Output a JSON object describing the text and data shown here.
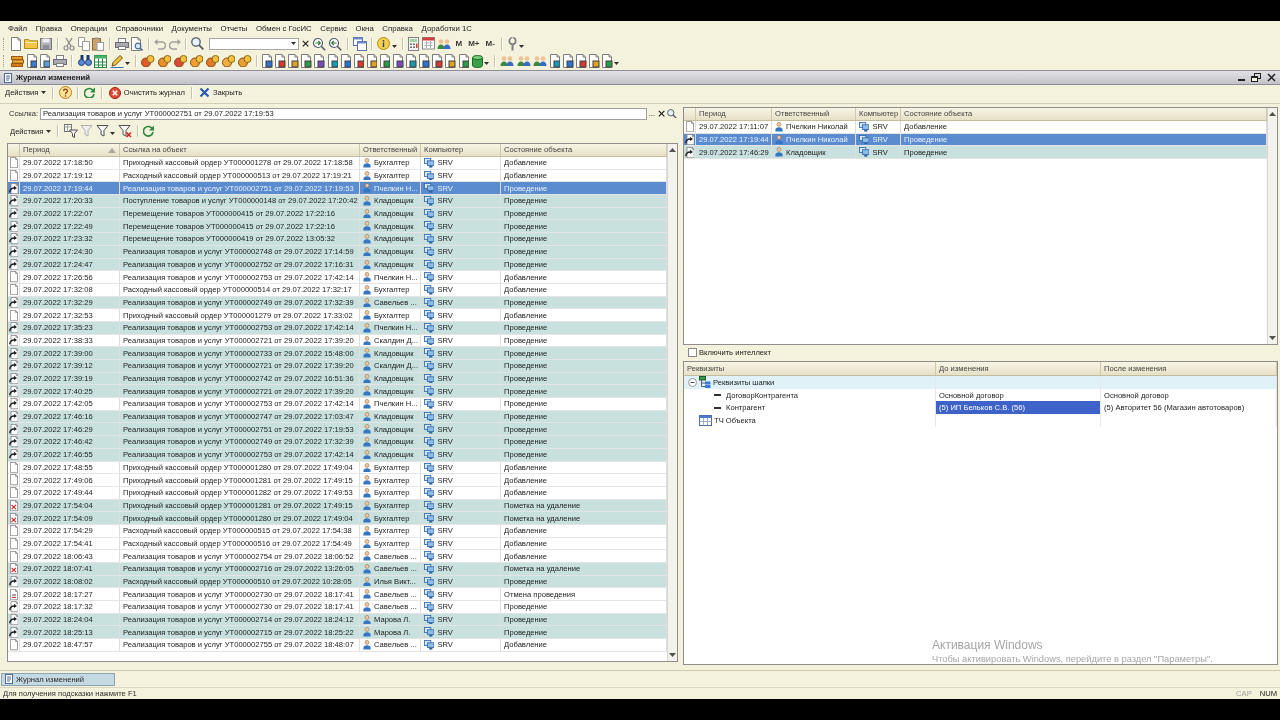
{
  "menu_bar": [
    "Файл",
    "Правка",
    "Операции",
    "Справочники",
    "Документы",
    "Отчеты",
    "Обмен с ГосИС",
    "Сервис",
    "Окна",
    "Справка",
    "Доработки 1С"
  ],
  "toolbar": {
    "memory_buttons": [
      "M",
      "M+",
      "M-"
    ]
  },
  "window": {
    "title": "Журнал изменений",
    "actions": [
      {
        "kind": "menu",
        "label": "Действия"
      },
      {
        "kind": "help"
      },
      {
        "kind": "refresh"
      },
      {
        "kind": "clear",
        "label": "Очистить журнал"
      },
      {
        "kind": "close",
        "label": "Закрыть"
      }
    ]
  },
  "link_field": {
    "label": "Ссылка:",
    "value": "Реализация товаров и услуг УТ000002751 от 29.07.2022 17:19:53",
    "select_button": "..."
  },
  "list_toolbar": {
    "actions": [
      {
        "kind": "menu",
        "label": "Действия"
      },
      {
        "kind": "filter_value"
      },
      {
        "kind": "filter_off"
      },
      {
        "kind": "filter_menu"
      },
      {
        "kind": "filter_clear"
      },
      {
        "kind": "refresh"
      }
    ]
  },
  "log_table": {
    "columns": [
      {
        "label": "Период",
        "sorted": true
      },
      {
        "label": "Ссылка на объект",
        "sorted": false
      },
      {
        "label": "Ответственный",
        "sorted": false
      },
      {
        "label": "Компьютер",
        "sorted": false
      },
      {
        "label": "Состояние объекта",
        "sorted": false
      }
    ],
    "rows": [
      {
        "kind": "added",
        "period": "29.07.2022 17:18:50",
        "object": "Приходный кассовый ордер УТ000001278 от 29.07.2022 17:18:58",
        "user": "Бухгалтер",
        "computer": "SRV",
        "state": "Добавление",
        "highlighted": false,
        "selected": false
      },
      {
        "kind": "added",
        "period": "29.07.2022 17:19:12",
        "object": "Расходный кассовый ордер УТ000000513 от 29.07.2022 17:19:21",
        "user": "Бухгалтер",
        "computer": "SRV",
        "state": "Добавление",
        "highlighted": false,
        "selected": false
      },
      {
        "kind": "posted",
        "period": "29.07.2022 17:19:44",
        "object": "Реализация товаров и услуг УТ000002751 от 29.07.2022 17:19:53",
        "user": "Пчелкин Н...",
        "computer": "SRV",
        "state": "Проведение",
        "highlighted": true,
        "selected": true
      },
      {
        "kind": "posted",
        "period": "29.07.2022 17:20:33",
        "object": "Поступление товаров и услуг УТ000000148 от 29.07.2022 17:20:42",
        "user": "Кладовщик",
        "computer": "SRV",
        "state": "Проведение",
        "highlighted": true,
        "selected": false
      },
      {
        "kind": "posted",
        "period": "29.07.2022 17:22:07",
        "object": "Перемещение товаров УТ000000415 от 29.07.2022 17:22:16",
        "user": "Кладовщик",
        "computer": "SRV",
        "state": "Проведение",
        "highlighted": true,
        "selected": false
      },
      {
        "kind": "posted",
        "period": "29.07.2022 17:22:49",
        "object": "Перемещение товаров УТ000000415 от 29.07.2022 17:22:16",
        "user": "Кладовщик",
        "computer": "SRV",
        "state": "Проведение",
        "highlighted": true,
        "selected": false
      },
      {
        "kind": "posted",
        "period": "29.07.2022 17:23:32",
        "object": "Перемещение товаров УТ000000419 от 29.07.2022 13:05:32",
        "user": "Кладовщик",
        "computer": "SRV",
        "state": "Проведение",
        "highlighted": true,
        "selected": false
      },
      {
        "kind": "posted",
        "period": "29.07.2022 17:24:30",
        "object": "Реализация товаров и услуг УТ000002748 от 29.07.2022 17:14:59",
        "user": "Кладовщик",
        "computer": "SRV",
        "state": "Проведение",
        "highlighted": true,
        "selected": false
      },
      {
        "kind": "posted",
        "period": "29.07.2022 17:24:47",
        "object": "Реализация товаров и услуг УТ000002752 от 29.07.2022 17:16:31",
        "user": "Кладовщик",
        "computer": "SRV",
        "state": "Проведение",
        "highlighted": true,
        "selected": false
      },
      {
        "kind": "added",
        "period": "29.07.2022 17:26:56",
        "object": "Реализация товаров и услуг УТ000002753 от 29.07.2022 17:42:14",
        "user": "Пчелкин Н...",
        "computer": "SRV",
        "state": "Добавление",
        "highlighted": false,
        "selected": false
      },
      {
        "kind": "added",
        "period": "29.07.2022 17:32:08",
        "object": "Расходный кассовый ордер УТ000000514 от 29.07.2022 17:32:17",
        "user": "Бухгалтер",
        "computer": "SRV",
        "state": "Добавление",
        "highlighted": false,
        "selected": false
      },
      {
        "kind": "posted",
        "period": "29.07.2022 17:32:29",
        "object": "Реализация товаров и услуг УТ000002749 от 29.07.2022 17:32:39",
        "user": "Савельев ...",
        "computer": "SRV",
        "state": "Проведение",
        "highlighted": true,
        "selected": false
      },
      {
        "kind": "added",
        "period": "29.07.2022 17:32:53",
        "object": "Приходный кассовый ордер УТ000001279 от 29.07.2022 17:33:02",
        "user": "Бухгалтер",
        "computer": "SRV",
        "state": "Добавление",
        "highlighted": false,
        "selected": false
      },
      {
        "kind": "posted",
        "period": "29.07.2022 17:35:23",
        "object": "Реализация товаров и услуг УТ000002753 от 29.07.2022 17:42:14",
        "user": "Пчелкин Н...",
        "computer": "SRV",
        "state": "Проведение",
        "highlighted": true,
        "selected": false
      },
      {
        "kind": "posted",
        "period": "29.07.2022 17:38:33",
        "object": "Реализация товаров и услуг УТ000002721 от 29.07.2022 17:39:20",
        "user": "Скалдин Д...",
        "computer": "SRV",
        "state": "Проведение",
        "highlighted": false,
        "selected": false
      },
      {
        "kind": "posted",
        "period": "29.07.2022 17:39:00",
        "object": "Реализация товаров и услуг УТ000002733 от 29.07.2022 15:48:00",
        "user": "Кладовщик",
        "computer": "SRV",
        "state": "Проведение",
        "highlighted": true,
        "selected": false
      },
      {
        "kind": "posted",
        "period": "29.07.2022 17:39:12",
        "object": "Реализация товаров и услуг УТ000002721 от 29.07.2022 17:39:20",
        "user": "Скалдин Д...",
        "computer": "SRV",
        "state": "Проведение",
        "highlighted": true,
        "selected": false
      },
      {
        "kind": "posted",
        "period": "29.07.2022 17:39:19",
        "object": "Реализация товаров и услуг УТ000002742 от 29.07.2022 16:51:36",
        "user": "Кладовщик",
        "computer": "SRV",
        "state": "Проведение",
        "highlighted": true,
        "selected": false
      },
      {
        "kind": "posted",
        "period": "29.07.2022 17:40:25",
        "object": "Реализация товаров и услуг УТ000002721 от 29.07.2022 17:39:20",
        "user": "Кладовщик",
        "computer": "SRV",
        "state": "Проведение",
        "highlighted": true,
        "selected": false
      },
      {
        "kind": "posted",
        "period": "29.07.2022 17:42:05",
        "object": "Реализация товаров и услуг УТ000002753 от 29.07.2022 17:42:14",
        "user": "Пчелкин Н...",
        "computer": "SRV",
        "state": "Проведение",
        "highlighted": false,
        "selected": false
      },
      {
        "kind": "posted",
        "period": "29.07.2022 17:46:16",
        "object": "Реализация товаров и услуг УТ000002747 от 29.07.2022 17:03:47",
        "user": "Кладовщик",
        "computer": "SRV",
        "state": "Проведение",
        "highlighted": true,
        "selected": false
      },
      {
        "kind": "posted",
        "period": "29.07.2022 17:46:29",
        "object": "Реализация товаров и услуг УТ000002751 от 29.07.2022 17:19:53",
        "user": "Кладовщик",
        "computer": "SRV",
        "state": "Проведение",
        "highlighted": true,
        "selected": false
      },
      {
        "kind": "posted",
        "period": "29.07.2022 17:46:42",
        "object": "Реализация товаров и услуг УТ000002749 от 29.07.2022 17:32:39",
        "user": "Кладовщик",
        "computer": "SRV",
        "state": "Проведение",
        "highlighted": true,
        "selected": false
      },
      {
        "kind": "posted",
        "period": "29.07.2022 17:46:55",
        "object": "Реализация товаров и услуг УТ000002753 от 29.07.2022 17:42:14",
        "user": "Кладовщик",
        "computer": "SRV",
        "state": "Проведение",
        "highlighted": true,
        "selected": false
      },
      {
        "kind": "added",
        "period": "29.07.2022 17:48:55",
        "object": "Приходный кассовый ордер УТ000001280 от 29.07.2022 17:49:04",
        "user": "Бухгалтер",
        "computer": "SRV",
        "state": "Добавление",
        "highlighted": false,
        "selected": false
      },
      {
        "kind": "added",
        "period": "29.07.2022 17:49:06",
        "object": "Приходный кассовый ордер УТ000001281 от 29.07.2022 17:49:15",
        "user": "Бухгалтер",
        "computer": "SRV",
        "state": "Добавление",
        "highlighted": false,
        "selected": false
      },
      {
        "kind": "added",
        "period": "29.07.2022 17:49:44",
        "object": "Приходный кассовый ордер УТ000001282 от 29.07.2022 17:49:53",
        "user": "Бухгалтер",
        "computer": "SRV",
        "state": "Добавление",
        "highlighted": false,
        "selected": false
      },
      {
        "kind": "marked",
        "period": "29.07.2022 17:54:04",
        "object": "Приходный кассовый ордер УТ000001281 от 29.07.2022 17:49:15",
        "user": "Бухгалтер",
        "computer": "SRV",
        "state": "Пометка на удаление",
        "highlighted": true,
        "selected": false
      },
      {
        "kind": "marked",
        "period": "29.07.2022 17:54:09",
        "object": "Приходный кассовый ордер УТ000001280 от 29.07.2022 17:49:04",
        "user": "Бухгалтер",
        "computer": "SRV",
        "state": "Пометка на удаление",
        "highlighted": true,
        "selected": false
      },
      {
        "kind": "added",
        "period": "29.07.2022 17:54:29",
        "object": "Расходный кассовый ордер УТ000000515 от 29.07.2022 17:54:38",
        "user": "Бухгалтер",
        "computer": "SRV",
        "state": "Добавление",
        "highlighted": false,
        "selected": false
      },
      {
        "kind": "added",
        "period": "29.07.2022 17:54:41",
        "object": "Расходный кассовый ордер УТ000000516 от 29.07.2022 17:54:49",
        "user": "Бухгалтер",
        "computer": "SRV",
        "state": "Добавление",
        "highlighted": false,
        "selected": false
      },
      {
        "kind": "added",
        "period": "29.07.2022 18:06:43",
        "object": "Реализация товаров и услуг УТ000002754 от 29.07.2022 18:06:52",
        "user": "Савельев ...",
        "computer": "SRV",
        "state": "Добавление",
        "highlighted": false,
        "selected": false
      },
      {
        "kind": "marked",
        "period": "29.07.2022 18:07:41",
        "object": "Реализация товаров и услуг УТ000002716 от 29.07.2022 13:26:05",
        "user": "Савельев ...",
        "computer": "SRV",
        "state": "Пометка на удаление",
        "highlighted": true,
        "selected": false
      },
      {
        "kind": "posted",
        "period": "29.07.2022 18:08:02",
        "object": "Расходный кассовый ордер УТ000000510 от 29.07.2022 10:28:05",
        "user": "Илья Викт...",
        "computer": "SRV",
        "state": "Проведение",
        "highlighted": true,
        "selected": false
      },
      {
        "kind": "unposted",
        "period": "29.07.2022 18:17:27",
        "object": "Реализация товаров и услуг УТ000002730 от 29.07.2022 18:17:41",
        "user": "Савельев ...",
        "computer": "SRV",
        "state": "Отмена проведения",
        "highlighted": false,
        "selected": false
      },
      {
        "kind": "posted",
        "period": "29.07.2022 18:17:32",
        "object": "Реализация товаров и услуг УТ000002730 от 29.07.2022 18:17:41",
        "user": "Савельев ...",
        "computer": "SRV",
        "state": "Проведение",
        "highlighted": false,
        "selected": false
      },
      {
        "kind": "posted",
        "period": "29.07.2022 18:24:04",
        "object": "Реализация товаров и услуг УТ000002714 от 29.07.2022 18:24:12",
        "user": "Марова Л.",
        "computer": "SRV",
        "state": "Проведение",
        "highlighted": true,
        "selected": false
      },
      {
        "kind": "posted",
        "period": "29.07.2022 18:25:13",
        "object": "Реализация товаров и услуг УТ000002715 от 29.07.2022 18:25:22",
        "user": "Марова Л.",
        "computer": "SRV",
        "state": "Проведение",
        "highlighted": true,
        "selected": false
      },
      {
        "kind": "added",
        "period": "29.07.2022 18:47:57",
        "object": "Реализация товаров и услуг УТ000002755 от 29.07.2022 18:48:07",
        "user": "Савельев ...",
        "computer": "SRV",
        "state": "Добавление",
        "highlighted": false,
        "selected": false
      }
    ]
  },
  "object_history": {
    "columns": [
      "Период",
      "Ответственный",
      "Компьютер",
      "Состояние объекта"
    ],
    "rows": [
      {
        "kind": "added",
        "period": "29.07.2022 17:11:07",
        "user": "Пчелкин Николай",
        "computer": "SRV",
        "state": "Добавление",
        "highlighted": false,
        "selected": false
      },
      {
        "kind": "posted",
        "period": "29.07.2022 17:19:44",
        "user": "Пчелкин Николай",
        "computer": "SRV",
        "state": "Проведение",
        "highlighted": true,
        "selected": true
      },
      {
        "kind": "posted",
        "period": "29.07.2022 17:46:29",
        "user": "Кладовщик",
        "computer": "SRV",
        "state": "Проведение",
        "highlighted": true,
        "selected": false
      }
    ]
  },
  "intellect_checkbox": {
    "label": "Включить интеллект",
    "checked": false
  },
  "changes_tree": {
    "columns": [
      "Реквизиты",
      "До изменения",
      "После изменения"
    ],
    "rows": [
      {
        "kind": "group",
        "name": "Реквизиты шапки",
        "expanded": true,
        "children": [
          {
            "kind": "attribute",
            "name": "ДоговорКонтрагента",
            "before": {
              "value": "Основной договор",
              "selected": false
            },
            "after": {
              "value": "Основной договор",
              "selected": false
            }
          },
          {
            "kind": "attribute",
            "name": "Контрагент",
            "before": {
              "value": "(5) ИП Бельков С.В. (56)",
              "selected": true
            },
            "after": {
              "value": "(5) Авторитет 56 (Магазин автотоваров)",
              "selected": false
            }
          }
        ]
      },
      {
        "kind": "table",
        "name": "ТЧ Объекта"
      }
    ]
  },
  "open_windows": [
    {
      "label": "Журнал изменений",
      "selected": true
    }
  ],
  "status_bar": {
    "hint": "Для получения подсказки нажмите F1",
    "indicators": [
      {
        "label": "CAP",
        "on": false
      },
      {
        "label": "NUM",
        "on": true
      }
    ]
  },
  "os_notice": {
    "title": "Активация Windows",
    "text": "Чтобы активировать Windows, перейдите в раздел \"Параметры\"."
  }
}
